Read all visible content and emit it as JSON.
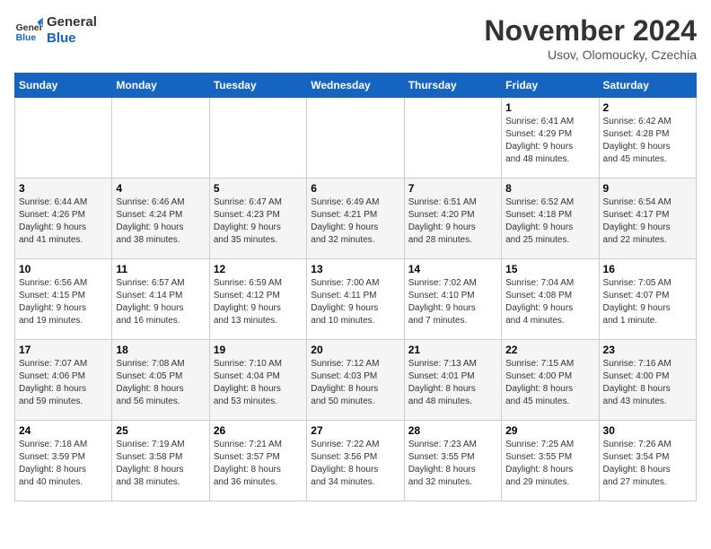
{
  "logo": {
    "line1": "General",
    "line2": "Blue"
  },
  "header": {
    "month": "November 2024",
    "location": "Usov, Olomoucky, Czechia"
  },
  "weekdays": [
    "Sunday",
    "Monday",
    "Tuesday",
    "Wednesday",
    "Thursday",
    "Friday",
    "Saturday"
  ],
  "weeks": [
    [
      {
        "day": "",
        "info": ""
      },
      {
        "day": "",
        "info": ""
      },
      {
        "day": "",
        "info": ""
      },
      {
        "day": "",
        "info": ""
      },
      {
        "day": "",
        "info": ""
      },
      {
        "day": "1",
        "info": "Sunrise: 6:41 AM\nSunset: 4:29 PM\nDaylight: 9 hours\nand 48 minutes."
      },
      {
        "day": "2",
        "info": "Sunrise: 6:42 AM\nSunset: 4:28 PM\nDaylight: 9 hours\nand 45 minutes."
      }
    ],
    [
      {
        "day": "3",
        "info": "Sunrise: 6:44 AM\nSunset: 4:26 PM\nDaylight: 9 hours\nand 41 minutes."
      },
      {
        "day": "4",
        "info": "Sunrise: 6:46 AM\nSunset: 4:24 PM\nDaylight: 9 hours\nand 38 minutes."
      },
      {
        "day": "5",
        "info": "Sunrise: 6:47 AM\nSunset: 4:23 PM\nDaylight: 9 hours\nand 35 minutes."
      },
      {
        "day": "6",
        "info": "Sunrise: 6:49 AM\nSunset: 4:21 PM\nDaylight: 9 hours\nand 32 minutes."
      },
      {
        "day": "7",
        "info": "Sunrise: 6:51 AM\nSunset: 4:20 PM\nDaylight: 9 hours\nand 28 minutes."
      },
      {
        "day": "8",
        "info": "Sunrise: 6:52 AM\nSunset: 4:18 PM\nDaylight: 9 hours\nand 25 minutes."
      },
      {
        "day": "9",
        "info": "Sunrise: 6:54 AM\nSunset: 4:17 PM\nDaylight: 9 hours\nand 22 minutes."
      }
    ],
    [
      {
        "day": "10",
        "info": "Sunrise: 6:56 AM\nSunset: 4:15 PM\nDaylight: 9 hours\nand 19 minutes."
      },
      {
        "day": "11",
        "info": "Sunrise: 6:57 AM\nSunset: 4:14 PM\nDaylight: 9 hours\nand 16 minutes."
      },
      {
        "day": "12",
        "info": "Sunrise: 6:59 AM\nSunset: 4:12 PM\nDaylight: 9 hours\nand 13 minutes."
      },
      {
        "day": "13",
        "info": "Sunrise: 7:00 AM\nSunset: 4:11 PM\nDaylight: 9 hours\nand 10 minutes."
      },
      {
        "day": "14",
        "info": "Sunrise: 7:02 AM\nSunset: 4:10 PM\nDaylight: 9 hours\nand 7 minutes."
      },
      {
        "day": "15",
        "info": "Sunrise: 7:04 AM\nSunset: 4:08 PM\nDaylight: 9 hours\nand 4 minutes."
      },
      {
        "day": "16",
        "info": "Sunrise: 7:05 AM\nSunset: 4:07 PM\nDaylight: 9 hours\nand 1 minute."
      }
    ],
    [
      {
        "day": "17",
        "info": "Sunrise: 7:07 AM\nSunset: 4:06 PM\nDaylight: 8 hours\nand 59 minutes."
      },
      {
        "day": "18",
        "info": "Sunrise: 7:08 AM\nSunset: 4:05 PM\nDaylight: 8 hours\nand 56 minutes."
      },
      {
        "day": "19",
        "info": "Sunrise: 7:10 AM\nSunset: 4:04 PM\nDaylight: 8 hours\nand 53 minutes."
      },
      {
        "day": "20",
        "info": "Sunrise: 7:12 AM\nSunset: 4:03 PM\nDaylight: 8 hours\nand 50 minutes."
      },
      {
        "day": "21",
        "info": "Sunrise: 7:13 AM\nSunset: 4:01 PM\nDaylight: 8 hours\nand 48 minutes."
      },
      {
        "day": "22",
        "info": "Sunrise: 7:15 AM\nSunset: 4:00 PM\nDaylight: 8 hours\nand 45 minutes."
      },
      {
        "day": "23",
        "info": "Sunrise: 7:16 AM\nSunset: 4:00 PM\nDaylight: 8 hours\nand 43 minutes."
      }
    ],
    [
      {
        "day": "24",
        "info": "Sunrise: 7:18 AM\nSunset: 3:59 PM\nDaylight: 8 hours\nand 40 minutes."
      },
      {
        "day": "25",
        "info": "Sunrise: 7:19 AM\nSunset: 3:58 PM\nDaylight: 8 hours\nand 38 minutes."
      },
      {
        "day": "26",
        "info": "Sunrise: 7:21 AM\nSunset: 3:57 PM\nDaylight: 8 hours\nand 36 minutes."
      },
      {
        "day": "27",
        "info": "Sunrise: 7:22 AM\nSunset: 3:56 PM\nDaylight: 8 hours\nand 34 minutes."
      },
      {
        "day": "28",
        "info": "Sunrise: 7:23 AM\nSunset: 3:55 PM\nDaylight: 8 hours\nand 32 minutes."
      },
      {
        "day": "29",
        "info": "Sunrise: 7:25 AM\nSunset: 3:55 PM\nDaylight: 8 hours\nand 29 minutes."
      },
      {
        "day": "30",
        "info": "Sunrise: 7:26 AM\nSunset: 3:54 PM\nDaylight: 8 hours\nand 27 minutes."
      }
    ]
  ]
}
